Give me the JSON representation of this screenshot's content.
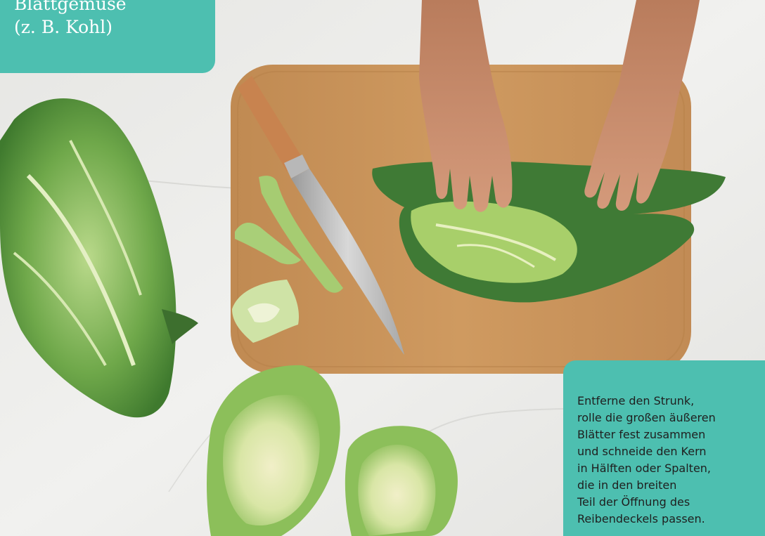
{
  "title": {
    "line1": "Blattgemüse",
    "line2": "(z. B. Kohl)"
  },
  "instructions": {
    "lines": [
      "Entferne den Strunk,",
      "rolle die großen äußeren",
      "Blätter fest zusammen",
      "und schneide den Kern",
      "in Hälften oder Spalten,",
      "die in den breiten",
      "Teil der Öffnung des",
      "Reibendeckels passen."
    ]
  },
  "colors": {
    "accent": "#4dbfb0",
    "title_text": "#ffffff",
    "body_text": "#1f1f1f",
    "background": "#ededeb"
  }
}
